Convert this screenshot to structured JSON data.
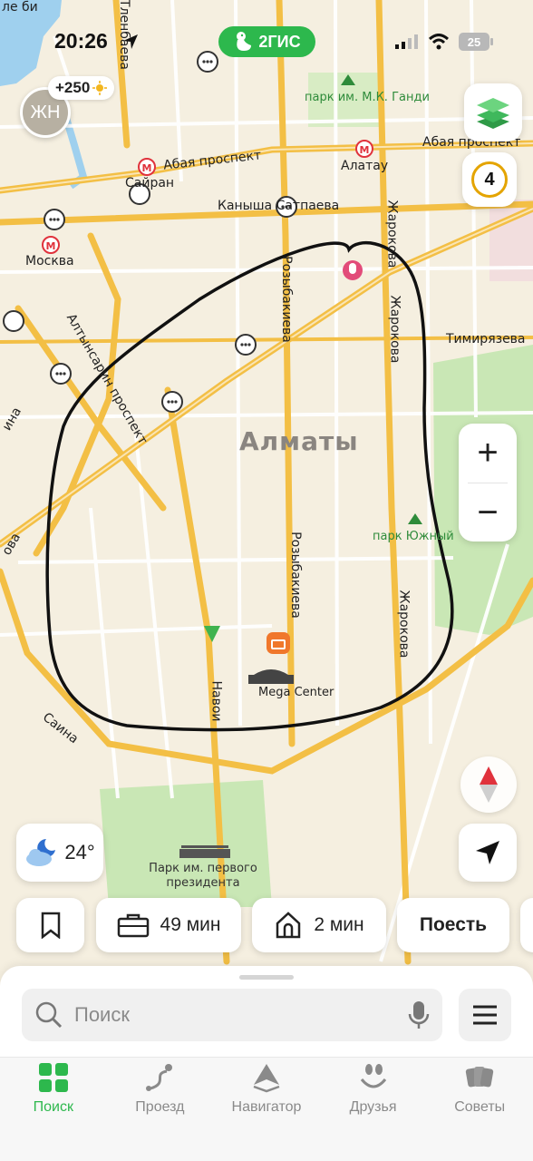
{
  "status_bar": {
    "time": "20:26",
    "battery": "25",
    "brand": "2ГИС"
  },
  "profile": {
    "initials": "ЖН",
    "points": "+250"
  },
  "map": {
    "city": "Алматы",
    "places": {
      "park_gandhi": "парк им. М.К. Ганди",
      "park_yuzhny": "парк Южный",
      "park_president": "Парк им. первого президента",
      "mega_center": "Mega Center"
    },
    "metro": {
      "sairan": "Сайран",
      "moskva": "Москва",
      "alatau": "Алатау"
    },
    "roads": {
      "abay_left": "Абая проспект",
      "abay_right": "Абая проспект",
      "kanysha": "Каныша Сатпаева",
      "rozybakieva_top": "Розыбакиева",
      "rozybakieva_bottom": "Розыбакиева",
      "zharokova_1": "Жарокова",
      "zharokova_2": "Жарокова",
      "zharokova_3": "Жарокова",
      "timiryazeva": "Тимирязева",
      "navoi": "Навои",
      "saina": "Саина",
      "altynsarin": "Алтынсарин проспект",
      "tlenbaeva": "Тленбаева",
      "bi": "ле би",
      "ina": "ина",
      "ova": "ова"
    }
  },
  "controls": {
    "traffic_level": "4",
    "zoom_in": "+",
    "zoom_out": "−"
  },
  "weather": {
    "temp": "24°"
  },
  "chips": {
    "work_time": "49 мин",
    "home_time": "2 мин",
    "eat": "Поесть"
  },
  "search": {
    "placeholder": "Поиск"
  },
  "tabs": [
    {
      "label": "Поиск"
    },
    {
      "label": "Проезд"
    },
    {
      "label": "Навигатор"
    },
    {
      "label": "Друзья"
    },
    {
      "label": "Советы"
    }
  ],
  "colors": {
    "accent": "#2db84d",
    "road": "#f3bf45",
    "park": "#c9e7b5",
    "water": "#9fd0ee",
    "metro": "#e0323c"
  }
}
